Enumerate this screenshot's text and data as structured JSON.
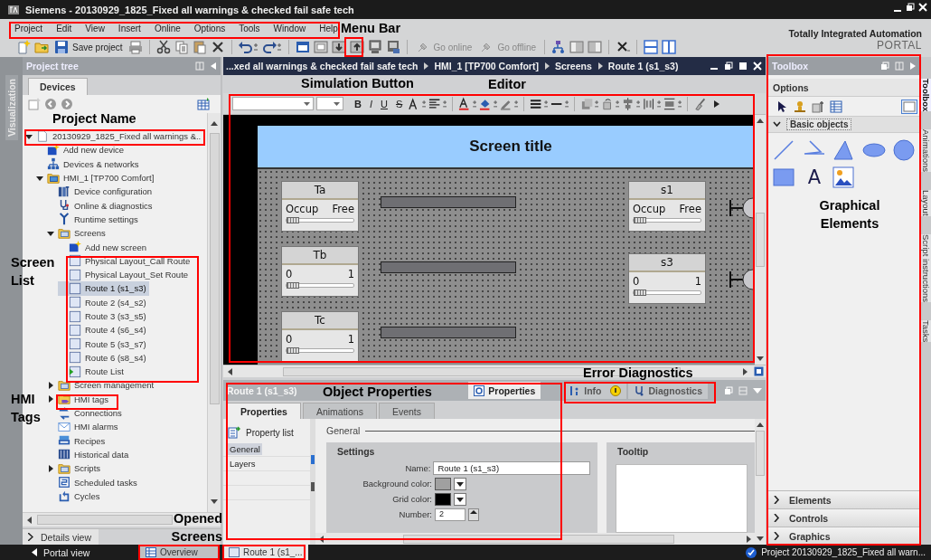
{
  "window": {
    "title": "Siemens  -  20130929_1825_Fixed all warnings & checked fail safe tech"
  },
  "menu_bar": [
    "Project",
    "Edit",
    "View",
    "Insert",
    "Online",
    "Options",
    "Tools",
    "Window",
    "Help"
  ],
  "toolbar": {
    "save_label": "Save project",
    "online": {
      "label": "Go online",
      "disabled": true
    },
    "offline": {
      "label": "Go offline",
      "disabled": true
    }
  },
  "branding": {
    "name": "Totally Integrated Automation",
    "product": "PORTAL"
  },
  "side_strip": {
    "label": "Visualization"
  },
  "project_tree": {
    "title": "Project tree",
    "tabs": [
      {
        "label": "Devices",
        "selected": true
      }
    ],
    "details_view": "Details view",
    "items": [
      {
        "label": "20130929_1825_Fixed all warnings &..",
        "kind": "project",
        "expanded": true,
        "selected": false,
        "children": [
          {
            "label": "Add new device",
            "kind": "add",
            "selected": false
          },
          {
            "label": "Devices & networks",
            "kind": "network",
            "selected": false
          },
          {
            "label": "HMI_1 [TP700 Comfort]",
            "kind": "device",
            "expanded": true,
            "selected": false,
            "children": [
              {
                "label": "Device configuration",
                "kind": "config",
                "selected": false
              },
              {
                "label": "Online & diagnostics",
                "kind": "diagnostics",
                "selected": false
              },
              {
                "label": "Runtime settings",
                "kind": "runtime",
                "selected": false
              },
              {
                "label": "Screens",
                "kind": "folder",
                "expanded": true,
                "selected": false,
                "children": [
                  {
                    "label": "Add new screen",
                    "kind": "add",
                    "selected": false
                  },
                  {
                    "label": "Physical Layout_Call Route",
                    "kind": "screen",
                    "selected": false
                  },
                  {
                    "label": "Physical Layout_Set Route",
                    "kind": "screen",
                    "selected": false
                  },
                  {
                    "label": "Route 1 (s1_s3)",
                    "kind": "screen",
                    "selected": true
                  },
                  {
                    "label": "Route 2 (s4_s2)",
                    "kind": "screen",
                    "selected": false
                  },
                  {
                    "label": "Route 3 (s3_s5)",
                    "kind": "screen",
                    "selected": false
                  },
                  {
                    "label": "Route 4 (s6_s4)",
                    "kind": "screen",
                    "selected": false
                  },
                  {
                    "label": "Route 5 (s3_s7)",
                    "kind": "screen",
                    "selected": false
                  },
                  {
                    "label": "Route 6 (s8_s4)",
                    "kind": "screen",
                    "selected": false
                  },
                  {
                    "label": "Route List",
                    "kind": "start-screen",
                    "selected": false
                  }
                ]
              },
              {
                "label": "Screen management",
                "kind": "folder",
                "expanded": false,
                "selected": false
              },
              {
                "label": "HMI tags",
                "kind": "folder-tags",
                "expanded": false,
                "selected": false
              },
              {
                "label": "Connections",
                "kind": "connections",
                "selected": false
              },
              {
                "label": "HMI alarms",
                "kind": "alarms",
                "selected": false
              },
              {
                "label": "Recipes",
                "kind": "recipes",
                "selected": false
              },
              {
                "label": "Historical data",
                "kind": "historical",
                "selected": false
              },
              {
                "label": "Scripts",
                "kind": "folder",
                "expanded": false,
                "selected": false
              },
              {
                "label": "Scheduled tasks",
                "kind": "tasks",
                "selected": false
              },
              {
                "label": "Cycles",
                "kind": "cycles",
                "selected": false
              }
            ]
          }
        ]
      }
    ]
  },
  "editor": {
    "breadcrumb": [
      "...xed all warnings & checked fail safe tech",
      "HMI_1 [TP700 Comfort]",
      "Screens",
      "Route 1 (s1_s3)"
    ],
    "format_buttons": [
      "B",
      "I",
      "U",
      "S"
    ],
    "screen": {
      "title": "Screen title",
      "tracks": [
        {
          "label": "Ta",
          "min": "Occup",
          "max": "Free",
          "level": 0
        },
        {
          "label": "Tb",
          "min": "0",
          "max": "1",
          "level": 0
        },
        {
          "label": "Tc",
          "min": "0",
          "max": "1",
          "level": 0
        }
      ],
      "signals": [
        {
          "label": "s1",
          "min": "Occup",
          "max": "Free",
          "level": 0
        },
        {
          "label": "s3",
          "min": "0",
          "max": "1",
          "level": 0
        }
      ]
    }
  },
  "inspector": {
    "title": "Route 1 (s1_s3)",
    "tabs": [
      {
        "label": "Properties",
        "kind": "properties",
        "selected": true
      },
      {
        "label": "Info",
        "kind": "info",
        "selected": false
      },
      {
        "label": "Diagnostics",
        "kind": "diagnostics",
        "selected": false
      }
    ],
    "subtabs": [
      {
        "label": "Properties",
        "selected": true
      },
      {
        "label": "Animations",
        "selected": false
      },
      {
        "label": "Events",
        "selected": false
      }
    ],
    "property_list": {
      "title": "Property list",
      "items": [
        {
          "label": "General",
          "selected": true
        },
        {
          "label": "Layers",
          "selected": false
        }
      ]
    },
    "section": "General",
    "settings": {
      "title": "Settings",
      "fields": [
        {
          "label": "Name:",
          "kind": "text",
          "value": "Route 1 (s1_s3)"
        },
        {
          "label": "Background color:",
          "kind": "color",
          "color": "#a0a0a0"
        },
        {
          "label": "Grid color:",
          "kind": "color",
          "color": "#000000"
        },
        {
          "label": "Number:",
          "kind": "number",
          "value": "2"
        }
      ]
    },
    "tooltip": {
      "title": "Tooltip"
    }
  },
  "toolbox": {
    "title": "Toolbox",
    "options": "Options",
    "basic_objects": {
      "title": "Basic objects",
      "expanded": true,
      "items": [
        {
          "kind": "line"
        },
        {
          "kind": "polyline"
        },
        {
          "kind": "polygon"
        },
        {
          "kind": "ellipse"
        },
        {
          "kind": "circle"
        },
        {
          "kind": "rectangle"
        },
        {
          "kind": "text",
          "glyph": "A"
        },
        {
          "kind": "graphic"
        }
      ]
    },
    "palettes": [
      {
        "label": "Elements",
        "expanded": false
      },
      {
        "label": "Controls",
        "expanded": false
      },
      {
        "label": "Graphics",
        "expanded": false
      }
    ]
  },
  "side_tabs": [
    {
      "label": "Toolbox",
      "selected": true
    },
    {
      "label": "Animations",
      "selected": false
    },
    {
      "label": "Layout",
      "selected": false
    },
    {
      "label": "Script instructions",
      "selected": false
    },
    {
      "label": "Tasks",
      "selected": false
    }
  ],
  "taskbar": {
    "portal_view": "Portal view",
    "tabs": [
      {
        "label": "Overview",
        "kind": "overview",
        "selected": false
      },
      {
        "label": "Route 1 (s1_...",
        "kind": "screen",
        "selected": true
      }
    ],
    "status": "Project 20130929_1825_Fixed all warn..."
  },
  "annotations": [
    "Menu Bar",
    "Simulation Button",
    "Editor",
    "Project Name",
    "Screen List",
    "HMI Tags",
    "Error Diagnostics",
    "Object Properties",
    "Graphical Elements",
    "Opened Screens"
  ]
}
